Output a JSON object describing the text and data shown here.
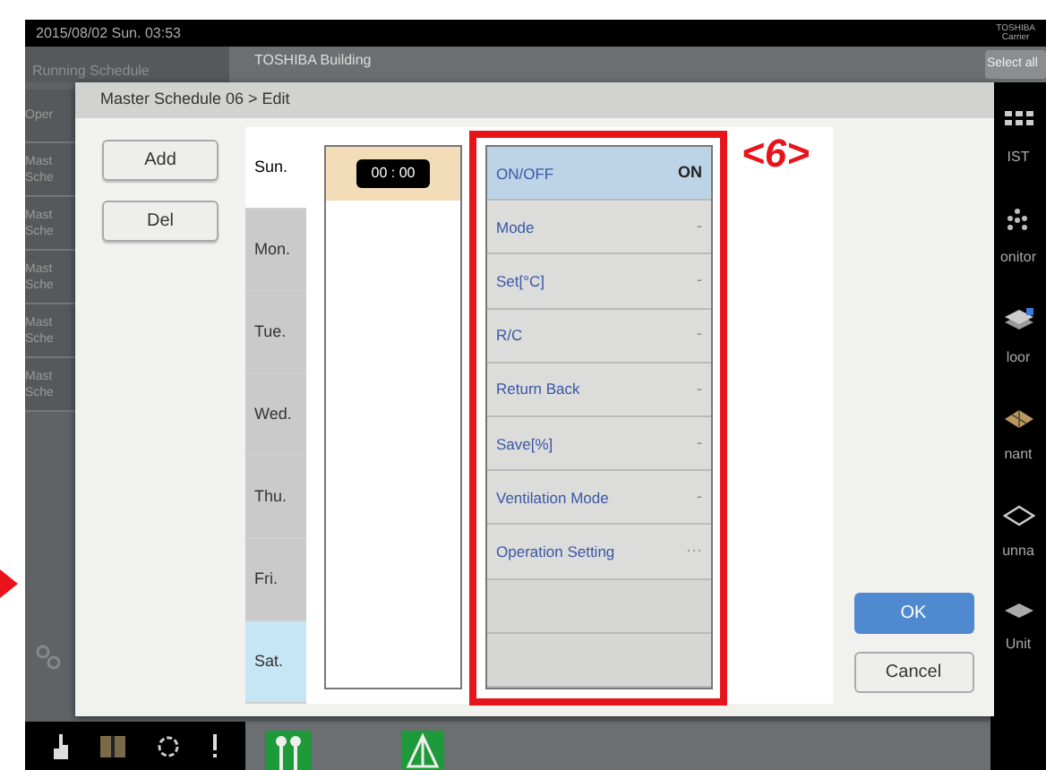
{
  "status_bar": {
    "datetime": "2015/08/02 Sun. 03:53",
    "logo": [
      "TOSHIBA",
      "Carrier"
    ]
  },
  "header": {
    "tab": "Running Schedule",
    "building": "TOSHIBA Building",
    "select_all": "Select all"
  },
  "background_list": [
    {
      "lines": [
        "Oper"
      ]
    },
    {
      "lines": [
        "Mast",
        "Sche"
      ]
    },
    {
      "lines": [
        "Mast",
        "Sche"
      ]
    },
    {
      "lines": [
        "Mast",
        "Sche"
      ]
    },
    {
      "lines": [
        "Mast",
        "Sche"
      ]
    },
    {
      "lines": [
        "Mast",
        "Sche"
      ]
    }
  ],
  "side_menu": [
    {
      "kind": "list",
      "label": "IST"
    },
    {
      "kind": "monitor",
      "label": "onitor"
    },
    {
      "kind": "floor",
      "label": "loor"
    },
    {
      "kind": "tenant",
      "label": "nant"
    },
    {
      "kind": "area",
      "label": "unna"
    },
    {
      "kind": "unit",
      "label": "Unit"
    }
  ],
  "dialog": {
    "title": "Master Schedule 06 > Edit",
    "buttons": [
      "Add",
      "Del"
    ],
    "days": [
      {
        "label": "Sun.",
        "selected": true,
        "highlighted": false
      },
      {
        "label": "Mon.",
        "selected": false,
        "highlighted": false
      },
      {
        "label": "Tue.",
        "selected": false,
        "highlighted": false
      },
      {
        "label": "Wed.",
        "selected": false,
        "highlighted": false
      },
      {
        "label": "Thu.",
        "selected": false,
        "highlighted": false
      },
      {
        "label": "Fri.",
        "selected": false,
        "highlighted": false
      },
      {
        "label": "Sat.",
        "selected": false,
        "highlighted": true
      }
    ],
    "time_slots": [
      {
        "time": "00 : 00",
        "selected": true
      }
    ],
    "settings": [
      {
        "label": "ON/OFF",
        "value": "ON",
        "selected": true
      },
      {
        "label": "Mode",
        "value": "-",
        "selected": false
      },
      {
        "label": "Set[°C]",
        "value": "-",
        "selected": false
      },
      {
        "label": "R/C",
        "value": "-",
        "selected": false
      },
      {
        "label": "Return Back",
        "value": "-",
        "selected": false
      },
      {
        "label": "Save[%]",
        "value": "-",
        "selected": false
      },
      {
        "label": "Ventilation Mode",
        "value": "-",
        "selected": false
      },
      {
        "label": "Operation Setting",
        "value": "···",
        "selected": false
      }
    ],
    "ok": "OK",
    "cancel": "Cancel"
  },
  "annotation": {
    "label": "<6>"
  }
}
